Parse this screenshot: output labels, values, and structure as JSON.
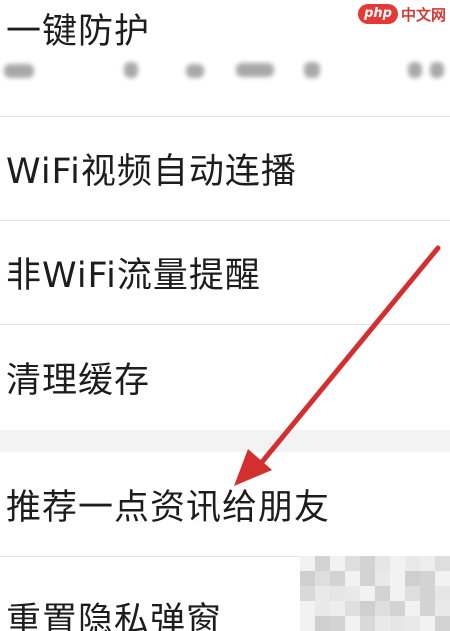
{
  "settings": {
    "items": [
      {
        "label": "一键防护"
      },
      {
        "label": "WiFi视频自动连播"
      },
      {
        "label": "非WiFi流量提醒"
      },
      {
        "label": "清理缓存"
      },
      {
        "label": "推荐一点资讯给朋友"
      },
      {
        "label": "重置隐私弹窗"
      }
    ]
  },
  "watermark": {
    "logo_text": "php",
    "site_text": "中文网"
  },
  "annotation": {
    "arrow_color": "#d32f2f",
    "arrow_icon": "red-arrow-icon"
  },
  "colors": {
    "background": "#ffffff",
    "divider": "#e6e6e6",
    "section_gap": "#f3f3f3",
    "text": "#1d1d1d"
  }
}
